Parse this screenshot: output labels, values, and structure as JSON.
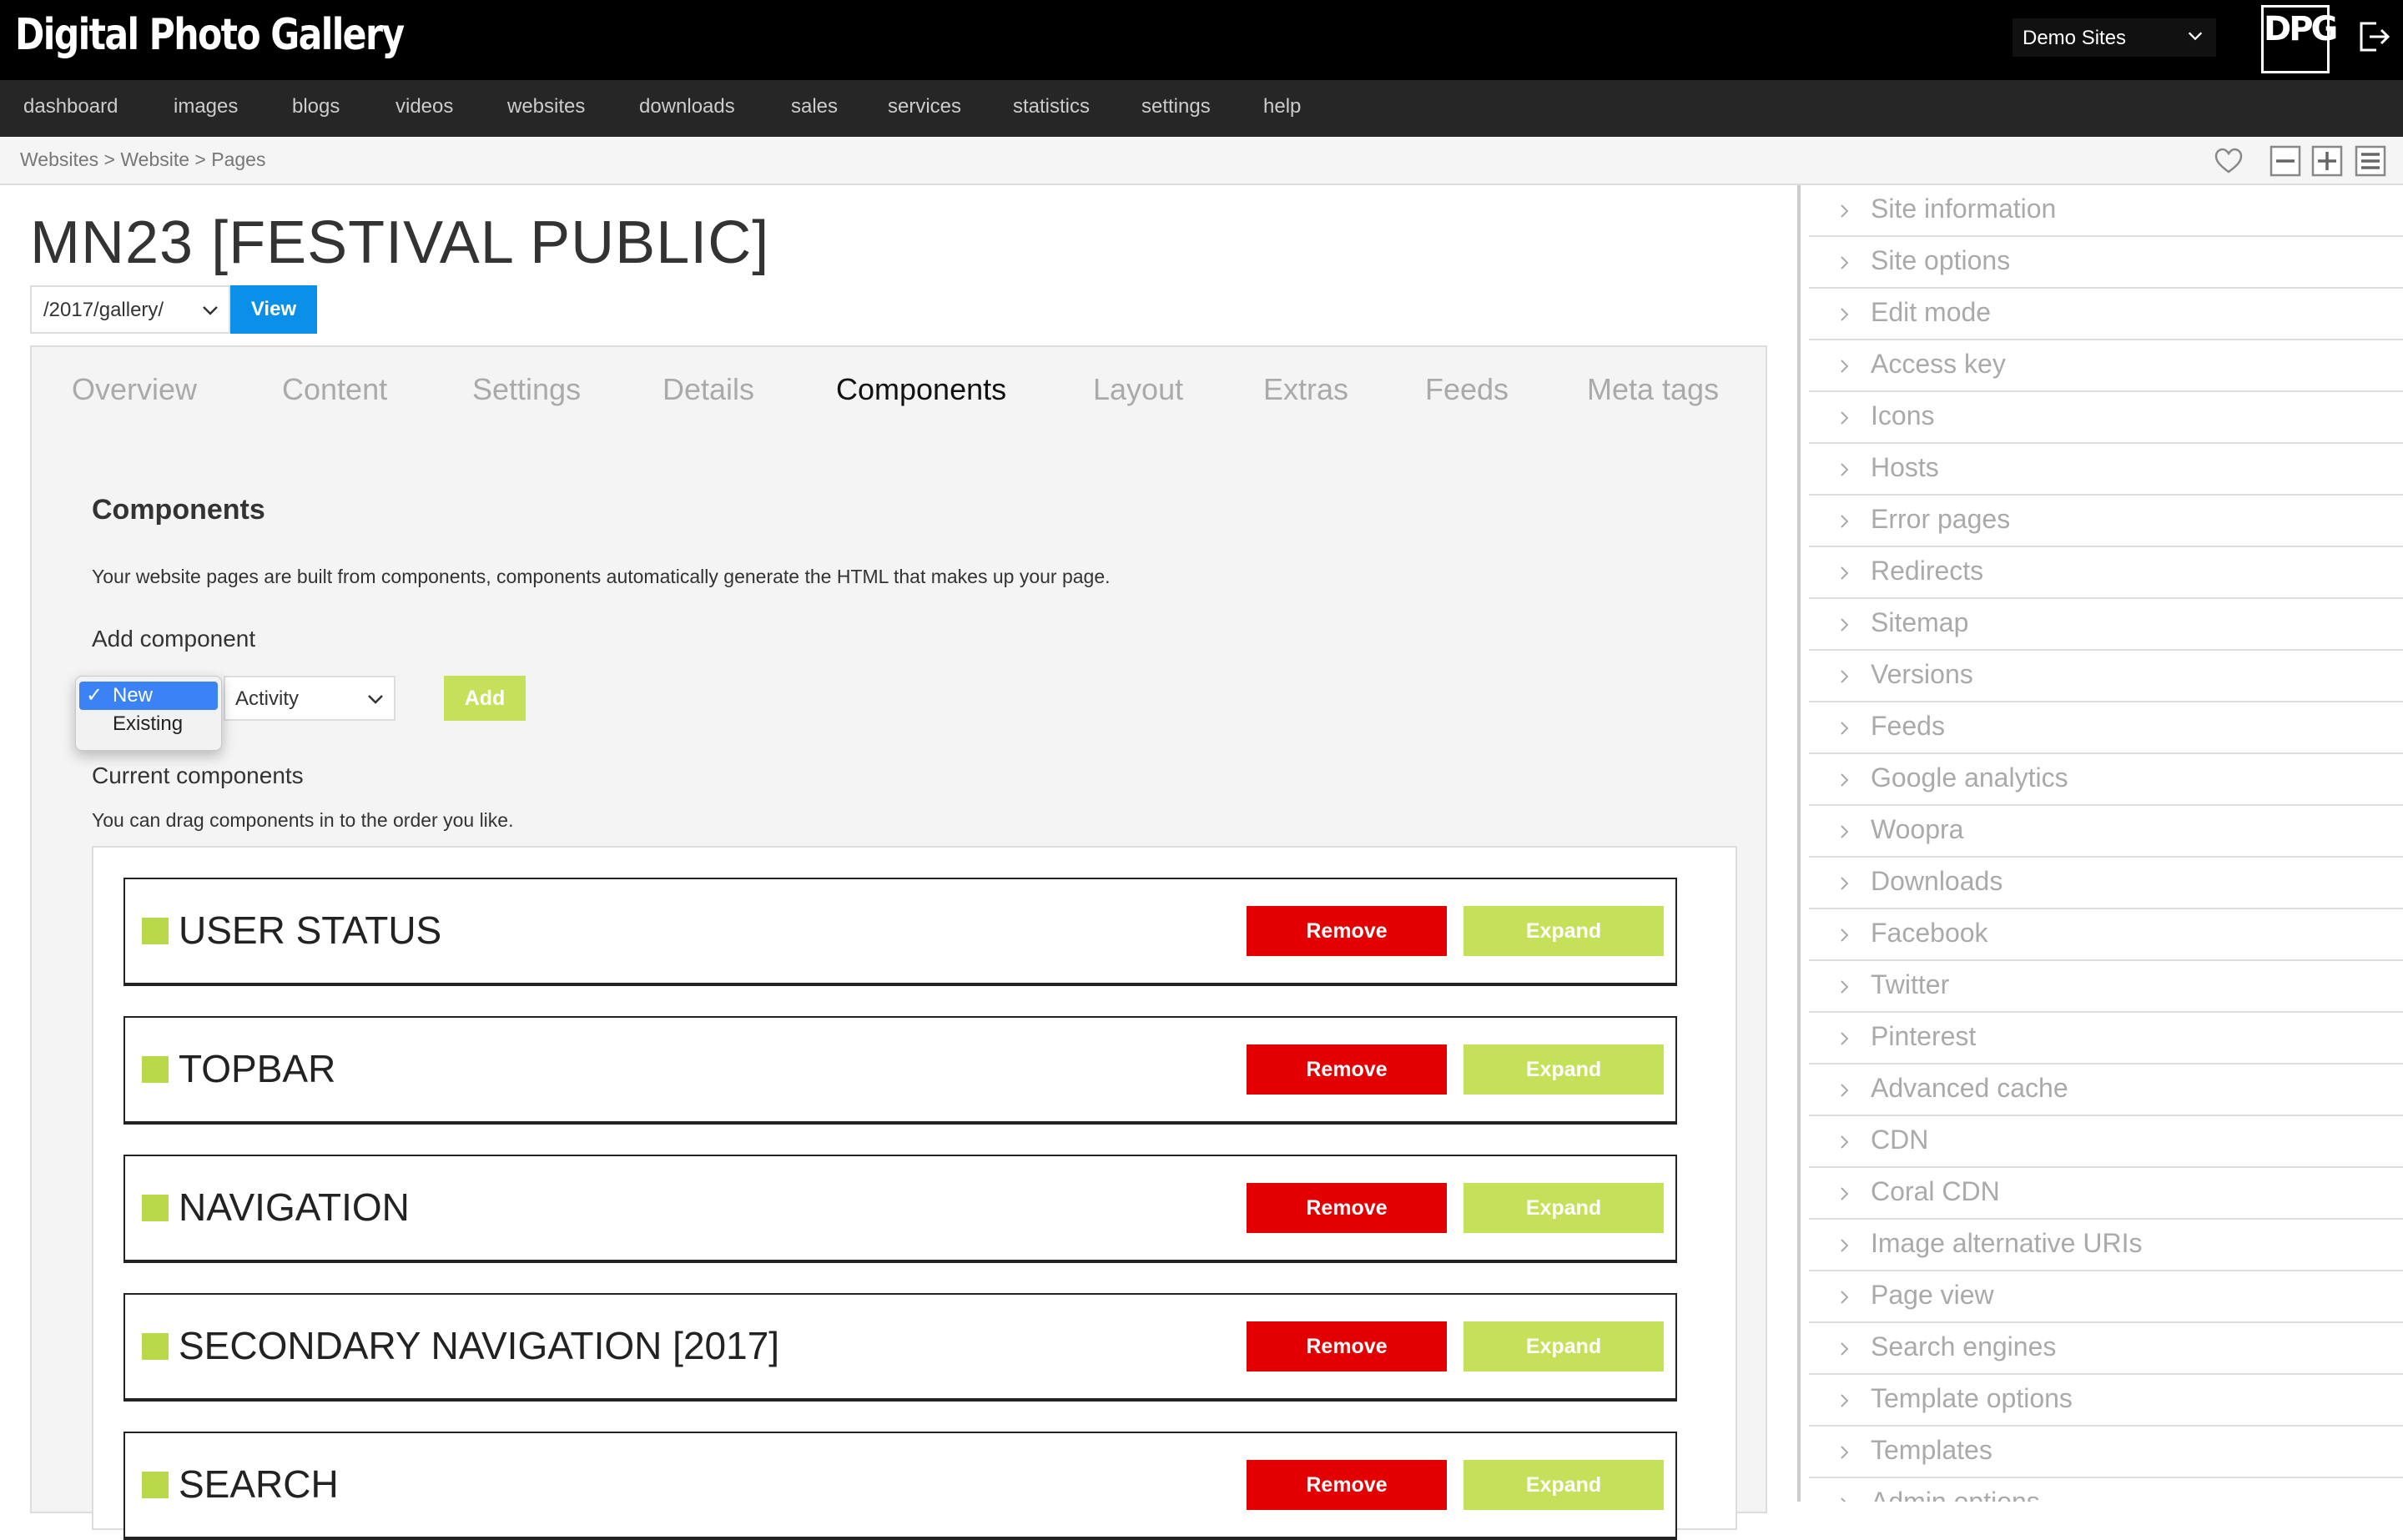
{
  "header": {
    "logo_text": "Digital Photo Gallery",
    "site_select_value": "Demo Sites",
    "dpg_logo_text": "DPG",
    "logout_icon": "logout-icon"
  },
  "nav": {
    "items": [
      "dashboard",
      "images",
      "blogs",
      "videos",
      "websites",
      "downloads",
      "sales",
      "services",
      "statistics",
      "settings",
      "help"
    ]
  },
  "breadcrumb": {
    "text": "Websites > Website > Pages"
  },
  "toolbar": {
    "icons": [
      "heart-icon",
      "minus-icon",
      "plus-icon",
      "menu-icon"
    ]
  },
  "page": {
    "title": "MN23 [FESTIVAL PUBLIC]",
    "path_value": "/2017/gallery/",
    "view_label": "View"
  },
  "tabs": [
    "Overview",
    "Content",
    "Settings",
    "Details",
    "Components",
    "Layout",
    "Extras",
    "Feeds",
    "Meta tags"
  ],
  "active_tab": "Components",
  "components_section": {
    "title": "Components",
    "description": "Your website pages are built from components, components automatically generate the HTML that makes up your page.",
    "add_label": "Add component",
    "mode_options": [
      "New",
      "Existing"
    ],
    "mode_selected": "New",
    "type_value": "Activity",
    "add_button": "Add",
    "current_label": "Current components",
    "current_desc": "You can drag components in to the order you like.",
    "remove_label": "Remove",
    "expand_label": "Expand",
    "components": [
      "USER STATUS",
      "TOPBAR",
      "NAVIGATION",
      "SECONDARY NAVIGATION [2017]",
      "SEARCH"
    ]
  },
  "sidebar": {
    "items": [
      "Site information",
      "Site options",
      "Edit mode",
      "Access key",
      "Icons",
      "Hosts",
      "Error pages",
      "Redirects",
      "Sitemap",
      "Versions",
      "Feeds",
      "Google analytics",
      "Woopra",
      "Downloads",
      "Facebook",
      "Twitter",
      "Pinterest",
      "Advanced cache",
      "CDN",
      "Coral CDN",
      "Image alternative URIs",
      "Page view",
      "Search engines",
      "Template options",
      "Templates",
      "Admin options"
    ]
  },
  "colors": {
    "accent_blue": "#0a90e8",
    "remove_red": "#e30000",
    "expand_green": "#c5e15a",
    "component_dot": "#b9d84a"
  }
}
